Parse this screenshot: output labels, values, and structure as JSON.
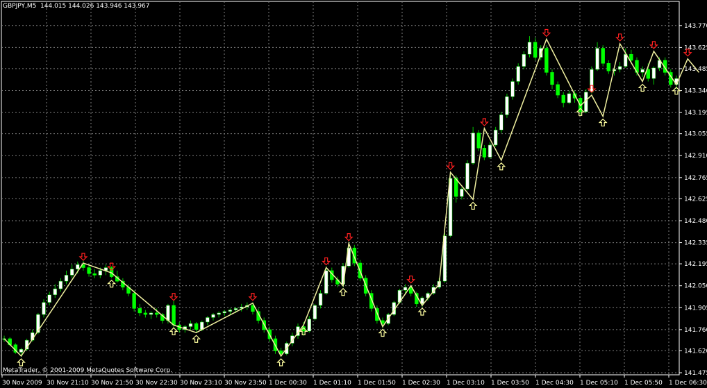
{
  "header": {
    "symbol": "GBPJPY,M5",
    "quote": "144.015 144.026 143.946 143.967"
  },
  "footer": {
    "copyright": "MetaTrader, © 2001-2009 MetaQuotes Software Corp."
  },
  "colors": {
    "background": "#000000",
    "grid": "#7f7f7f",
    "bull_body": "#ffffff",
    "bear_body": "#00ff00",
    "wick": "#00c800",
    "zigzag": "#f0f0a0",
    "down_arrow": "#ff2020",
    "up_arrow": "#ffffa0",
    "axis": "#ffffff"
  },
  "chart_data": {
    "type": "candlestick",
    "ylim": [
      141.475,
      143.815
    ],
    "x_ticks": [
      "30 Nov 2009",
      "30 Nov 21:10",
      "30 Nov 21:50",
      "30 Nov 22:30",
      "30 Nov 23:10",
      "30 Nov 23:50",
      "1 Dec 00:30",
      "1 Dec 01:10",
      "1 Dec 01:50",
      "1 Dec 02:30",
      "1 Dec 03:10",
      "1 Dec 03:50",
      "1 Dec 04:30",
      "1 Dec 05:10",
      "1 Dec 05:50",
      "1 Dec 06:30"
    ],
    "y_ticks": [
      143.77,
      143.625,
      143.485,
      143.34,
      143.195,
      143.055,
      142.91,
      142.765,
      142.625,
      142.48,
      142.335,
      142.195,
      142.05,
      141.905,
      141.76,
      141.62,
      141.475
    ],
    "zigzag": [
      [
        0,
        141.7
      ],
      [
        3,
        141.585
      ],
      [
        14,
        142.2
      ],
      [
        19,
        142.135
      ],
      [
        30,
        141.79
      ],
      [
        34,
        141.74
      ],
      [
        44,
        141.935
      ],
      [
        49,
        141.585
      ],
      [
        53,
        141.79
      ],
      [
        57,
        142.17
      ],
      [
        60,
        142.05
      ],
      [
        61,
        142.33
      ],
      [
        67,
        141.78
      ],
      [
        72,
        142.05
      ],
      [
        74,
        141.92
      ],
      [
        77,
        142.06
      ],
      [
        79,
        142.8
      ],
      [
        83,
        142.62
      ],
      [
        85,
        143.09
      ],
      [
        88,
        142.88
      ],
      [
        96,
        143.68
      ],
      [
        102,
        143.24
      ],
      [
        104,
        143.31
      ],
      [
        106,
        143.17
      ],
      [
        109,
        143.65
      ],
      [
        113,
        143.4
      ],
      [
        115,
        143.6
      ],
      [
        119,
        143.38
      ],
      [
        121,
        143.55
      ],
      [
        123,
        143.46
      ]
    ],
    "arrows_down": [
      [
        14,
        142.2
      ],
      [
        19,
        142.135
      ],
      [
        30,
        141.935
      ],
      [
        44,
        141.935
      ],
      [
        57,
        142.17
      ],
      [
        61,
        142.33
      ],
      [
        72,
        142.05
      ],
      [
        79,
        142.8
      ],
      [
        85,
        143.09
      ],
      [
        96,
        143.68
      ],
      [
        104,
        143.31
      ],
      [
        109,
        143.65
      ],
      [
        115,
        143.6
      ],
      [
        121,
        143.55
      ]
    ],
    "arrows_up": [
      [
        3,
        141.585
      ],
      [
        19,
        142.105
      ],
      [
        30,
        141.79
      ],
      [
        34,
        141.74
      ],
      [
        49,
        141.585
      ],
      [
        53,
        141.79
      ],
      [
        60,
        142.05
      ],
      [
        67,
        141.78
      ],
      [
        74,
        141.92
      ],
      [
        83,
        142.62
      ],
      [
        88,
        142.88
      ],
      [
        102,
        143.24
      ],
      [
        106,
        143.17
      ],
      [
        113,
        143.4
      ],
      [
        119,
        143.38
      ]
    ],
    "candles": [
      [
        141.695,
        141.72,
        141.68,
        141.7
      ],
      [
        141.7,
        141.71,
        141.65,
        141.66
      ],
      [
        141.66,
        141.67,
        141.6,
        141.61
      ],
      [
        141.61,
        141.64,
        141.58,
        141.63
      ],
      [
        141.63,
        141.7,
        141.62,
        141.69
      ],
      [
        141.69,
        141.76,
        141.68,
        141.74
      ],
      [
        141.74,
        141.87,
        141.73,
        141.86
      ],
      [
        141.86,
        141.96,
        141.84,
        141.94
      ],
      [
        141.94,
        142.01,
        141.92,
        141.99
      ],
      [
        141.99,
        142.06,
        141.97,
        142.03
      ],
      [
        142.03,
        142.1,
        142.01,
        142.08
      ],
      [
        142.08,
        142.15,
        142.06,
        142.12
      ],
      [
        142.12,
        142.19,
        142.1,
        142.16
      ],
      [
        142.16,
        142.21,
        142.13,
        142.19
      ],
      [
        142.19,
        142.215,
        142.15,
        142.17
      ],
      [
        142.17,
        142.19,
        142.11,
        142.13
      ],
      [
        142.13,
        142.16,
        142.1,
        142.12
      ],
      [
        142.12,
        142.17,
        142.1,
        142.15
      ],
      [
        142.15,
        142.19,
        142.12,
        142.17
      ],
      [
        142.17,
        142.18,
        142.1,
        142.11
      ],
      [
        142.11,
        142.15,
        142.07,
        142.08
      ],
      [
        142.08,
        142.1,
        142.02,
        142.04
      ],
      [
        142.04,
        142.06,
        141.98,
        142.0
      ],
      [
        142.0,
        142.02,
        141.88,
        141.9
      ],
      [
        141.9,
        141.93,
        141.85,
        141.87
      ],
      [
        141.87,
        141.89,
        141.84,
        141.86
      ],
      [
        141.86,
        141.88,
        141.83,
        141.87
      ],
      [
        141.87,
        141.9,
        141.84,
        141.86
      ],
      [
        141.86,
        141.87,
        141.8,
        141.82
      ],
      [
        141.82,
        141.93,
        141.8,
        141.92
      ],
      [
        141.92,
        141.95,
        141.77,
        141.79
      ],
      [
        141.79,
        141.81,
        141.74,
        141.76
      ],
      [
        141.76,
        141.79,
        141.74,
        141.78
      ],
      [
        141.78,
        141.82,
        141.76,
        141.8
      ],
      [
        141.8,
        141.81,
        141.74,
        141.76
      ],
      [
        141.76,
        141.82,
        141.75,
        141.81
      ],
      [
        141.81,
        141.85,
        141.79,
        141.84
      ],
      [
        141.84,
        141.87,
        141.82,
        141.86
      ],
      [
        141.86,
        141.88,
        141.84,
        141.87
      ],
      [
        141.87,
        141.89,
        141.85,
        141.88
      ],
      [
        141.88,
        141.9,
        141.86,
        141.89
      ],
      [
        141.89,
        141.91,
        141.87,
        141.9
      ],
      [
        141.9,
        141.93,
        141.88,
        141.91
      ],
      [
        141.91,
        141.94,
        141.89,
        141.92
      ],
      [
        141.92,
        141.94,
        141.86,
        141.88
      ],
      [
        141.88,
        141.9,
        141.8,
        141.82
      ],
      [
        141.82,
        141.84,
        141.74,
        141.76
      ],
      [
        141.76,
        141.78,
        141.68,
        141.7
      ],
      [
        141.7,
        141.72,
        141.6,
        141.62
      ],
      [
        141.62,
        141.64,
        141.58,
        141.6
      ],
      [
        141.6,
        141.68,
        141.59,
        141.67
      ],
      [
        141.67,
        141.74,
        141.65,
        141.72
      ],
      [
        141.72,
        141.8,
        141.7,
        141.78
      ],
      [
        141.78,
        141.81,
        141.72,
        141.75
      ],
      [
        141.75,
        141.85,
        141.74,
        141.83
      ],
      [
        141.83,
        141.93,
        141.82,
        141.92
      ],
      [
        141.92,
        142.02,
        141.9,
        142.0
      ],
      [
        142.0,
        142.18,
        141.99,
        142.15
      ],
      [
        142.15,
        142.17,
        142.07,
        142.09
      ],
      [
        142.09,
        142.11,
        142.04,
        142.06
      ],
      [
        142.06,
        142.2,
        142.04,
        142.18
      ],
      [
        142.18,
        142.34,
        142.17,
        142.3
      ],
      [
        142.3,
        142.32,
        142.18,
        142.2
      ],
      [
        142.2,
        142.22,
        142.08,
        142.1
      ],
      [
        142.1,
        142.12,
        141.98,
        142.0
      ],
      [
        142.0,
        142.02,
        141.88,
        141.9
      ],
      [
        141.9,
        141.92,
        141.8,
        141.82
      ],
      [
        141.82,
        141.84,
        141.77,
        141.8
      ],
      [
        141.8,
        141.87,
        141.79,
        141.86
      ],
      [
        141.86,
        141.95,
        141.85,
        141.94
      ],
      [
        141.94,
        142.03,
        141.93,
        142.02
      ],
      [
        142.02,
        142.06,
        142.0,
        142.04
      ],
      [
        142.04,
        142.05,
        141.98,
        142.0
      ],
      [
        142.0,
        142.01,
        141.91,
        141.93
      ],
      [
        141.93,
        141.98,
        141.91,
        141.97
      ],
      [
        141.97,
        142.01,
        141.95,
        142.0
      ],
      [
        142.0,
        142.06,
        141.99,
        142.04
      ],
      [
        142.04,
        142.1,
        142.03,
        142.08
      ],
      [
        142.08,
        142.4,
        142.07,
        142.38
      ],
      [
        142.38,
        142.8,
        142.37,
        142.76
      ],
      [
        142.76,
        142.78,
        142.6,
        142.64
      ],
      [
        142.64,
        142.7,
        142.62,
        142.69
      ],
      [
        142.69,
        142.88,
        142.68,
        142.86
      ],
      [
        142.86,
        143.1,
        142.85,
        143.06
      ],
      [
        143.06,
        143.08,
        142.94,
        142.96
      ],
      [
        142.96,
        142.98,
        142.88,
        142.9
      ],
      [
        142.9,
        143.0,
        142.89,
        142.98
      ],
      [
        142.98,
        143.1,
        142.97,
        143.08
      ],
      [
        143.08,
        143.2,
        143.06,
        143.18
      ],
      [
        143.18,
        143.32,
        143.16,
        143.3
      ],
      [
        143.3,
        143.42,
        143.28,
        143.4
      ],
      [
        143.4,
        143.52,
        143.38,
        143.5
      ],
      [
        143.5,
        143.6,
        143.48,
        143.58
      ],
      [
        143.58,
        143.7,
        143.56,
        143.66
      ],
      [
        143.66,
        143.69,
        143.54,
        143.56
      ],
      [
        143.56,
        143.64,
        143.54,
        143.62
      ],
      [
        143.62,
        143.64,
        143.44,
        143.46
      ],
      [
        143.46,
        143.48,
        143.35,
        143.38
      ],
      [
        143.38,
        143.4,
        143.29,
        143.31
      ],
      [
        143.31,
        143.33,
        143.23,
        143.26
      ],
      [
        143.26,
        143.34,
        143.25,
        143.32
      ],
      [
        143.32,
        143.34,
        143.26,
        143.29
      ],
      [
        143.29,
        143.3,
        143.18,
        143.2
      ],
      [
        143.2,
        143.35,
        143.19,
        143.33
      ],
      [
        143.33,
        143.5,
        143.32,
        143.48
      ],
      [
        143.48,
        143.66,
        143.47,
        143.62
      ],
      [
        143.62,
        143.64,
        143.5,
        143.52
      ],
      [
        143.52,
        143.54,
        143.45,
        143.47
      ],
      [
        143.47,
        143.5,
        143.44,
        143.48
      ],
      [
        143.48,
        143.53,
        143.46,
        143.5
      ],
      [
        143.5,
        143.62,
        143.49,
        143.58
      ],
      [
        143.58,
        143.61,
        143.52,
        143.54
      ],
      [
        143.54,
        143.56,
        143.44,
        143.46
      ],
      [
        143.46,
        143.5,
        143.43,
        143.48
      ],
      [
        143.48,
        143.52,
        143.4,
        143.42
      ],
      [
        143.42,
        143.5,
        143.38,
        143.49
      ],
      [
        143.49,
        143.56,
        143.47,
        143.54
      ],
      [
        143.54,
        143.56,
        143.44,
        143.46
      ],
      [
        143.46,
        143.48,
        143.36,
        143.38
      ],
      [
        143.38,
        143.44,
        143.35,
        143.42
      ]
    ]
  }
}
